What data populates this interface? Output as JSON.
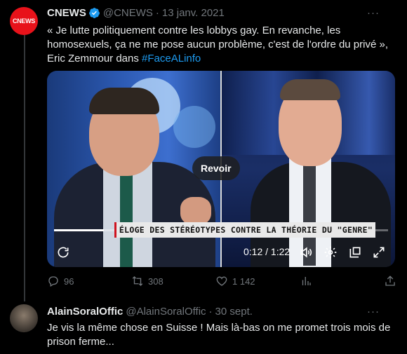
{
  "tweet": {
    "author_name": "CNEWS",
    "avatar_text": "CNEWS",
    "handle": "@CNEWS",
    "separator": "·",
    "date": "13 janv. 2021",
    "more": "···",
    "text_main": "« Je lutte politiquement contre les lobbys gay. En revanche, les homosexuels, ça ne me pose aucun problème, c'est de l'ordre du privé », Eric Zemmour dans ",
    "hashtag": "#FaceALinfo",
    "video": {
      "replay_label": "Revoir",
      "caption": "ÉLOGE DES STÉRÉOTYPES CONTRE LA THÉORIE DU \"GENRE\"",
      "time": "0:12 / 1:22",
      "progress": 0.15
    },
    "stats": {
      "replies": "96",
      "retweets": "308",
      "likes": "1 142"
    }
  },
  "reply": {
    "author_name": "AlainSoralOffic",
    "handle": "@AlainSoralOffic",
    "separator": "·",
    "date": "30 sept.",
    "more": "···",
    "text": "Je vis la même chose en Suisse ! Mais là-bas on me promet trois mois de prison ferme..."
  },
  "colors": {
    "accent": "#1d9bf0",
    "brand_red": "#e8121a",
    "muted": "#71767b"
  }
}
